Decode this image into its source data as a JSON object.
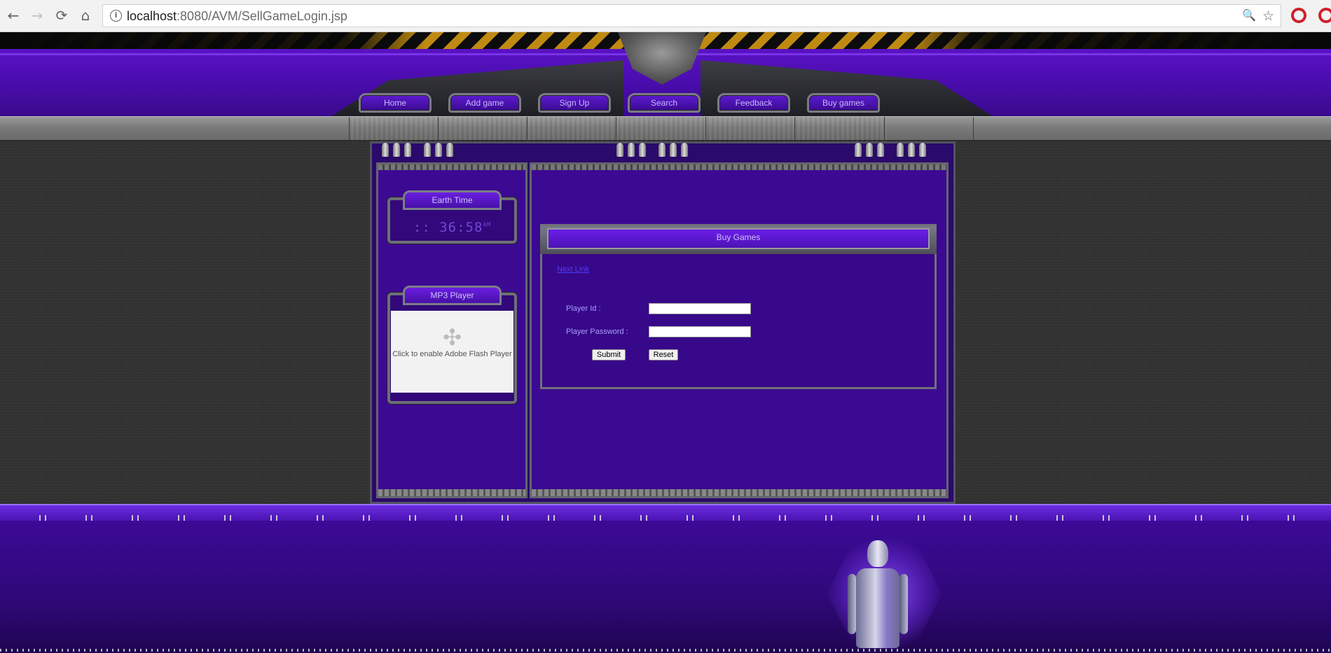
{
  "browser": {
    "url_host": "localhost",
    "url_rest": ":8080/AVM/SellGameLogin.jsp",
    "back_icon": "←",
    "forward_icon": "→",
    "reload_icon": "⟳",
    "home_icon": "⌂",
    "zoom_icon": "🔍",
    "star_icon": "☆"
  },
  "nav": {
    "items": [
      {
        "label": "Home"
      },
      {
        "label": "Add game"
      },
      {
        "label": "Sign Up"
      },
      {
        "label": "Search"
      },
      {
        "label": "Feedback"
      },
      {
        "label": "Buy games"
      }
    ]
  },
  "sidebar": {
    "earth_time_title": "Earth Time",
    "clock_value": ":: 36:58",
    "clock_suffix": "AM",
    "mp3_title": "MP3 Player",
    "flash_message": "Click to enable Adobe Flash Player"
  },
  "main": {
    "panel_title": "Buy Games",
    "next_link": "Next Link",
    "player_id_label": "Player Id :",
    "player_password_label": "Player Password :",
    "player_id_value": "",
    "player_password_value": "",
    "submit_label": "Submit",
    "reset_label": "Reset"
  },
  "colors": {
    "accent_purple": "#4b0db0",
    "link_blue": "#4a3dff",
    "steel_grey": "#7a7a7a"
  }
}
